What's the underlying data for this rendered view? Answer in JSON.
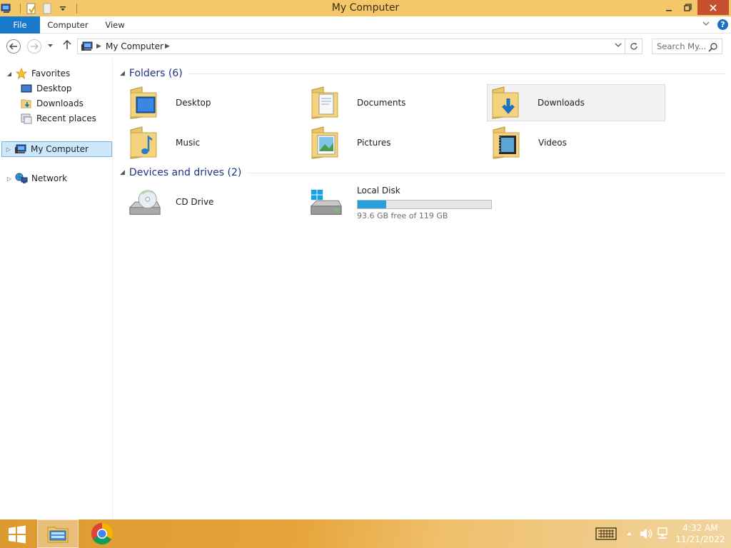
{
  "window": {
    "title": "My Computer",
    "accent_titlebar": "#f4c86a",
    "accent_file_tab": "#1979ca"
  },
  "ribbon": {
    "tabs": [
      {
        "label": "File"
      },
      {
        "label": "Computer"
      },
      {
        "label": "View"
      }
    ]
  },
  "addressbar": {
    "location": "My Computer",
    "search_placeholder": "Search My..."
  },
  "navpane": {
    "favorites_label": "Favorites",
    "favorites": [
      {
        "label": "Desktop",
        "icon": "desktop-icon"
      },
      {
        "label": "Downloads",
        "icon": "downloads-icon"
      },
      {
        "label": "Recent places",
        "icon": "recent-places-icon"
      }
    ],
    "computer_label": "My Computer",
    "network_label": "Network"
  },
  "content": {
    "folders_header": "Folders (6)",
    "folders": [
      {
        "label": "Desktop",
        "icon": "desktop-folder-icon"
      },
      {
        "label": "Documents",
        "icon": "documents-folder-icon"
      },
      {
        "label": "Downloads",
        "icon": "downloads-folder-icon"
      },
      {
        "label": "Music",
        "icon": "music-folder-icon"
      },
      {
        "label": "Pictures",
        "icon": "pictures-folder-icon"
      },
      {
        "label": "Videos",
        "icon": "videos-folder-icon"
      }
    ],
    "drives_header": "Devices and drives (2)",
    "drives": [
      {
        "label": "CD Drive",
        "icon": "cd-drive-icon"
      },
      {
        "label": "Local Disk",
        "icon": "local-disk-icon",
        "free_text": "93.6 GB free of 119 GB",
        "used_fraction": 0.213,
        "bar_color": "#26a0da"
      }
    ]
  },
  "taskbar": {
    "time": "4:32 AM",
    "date": "11/21/2022"
  }
}
